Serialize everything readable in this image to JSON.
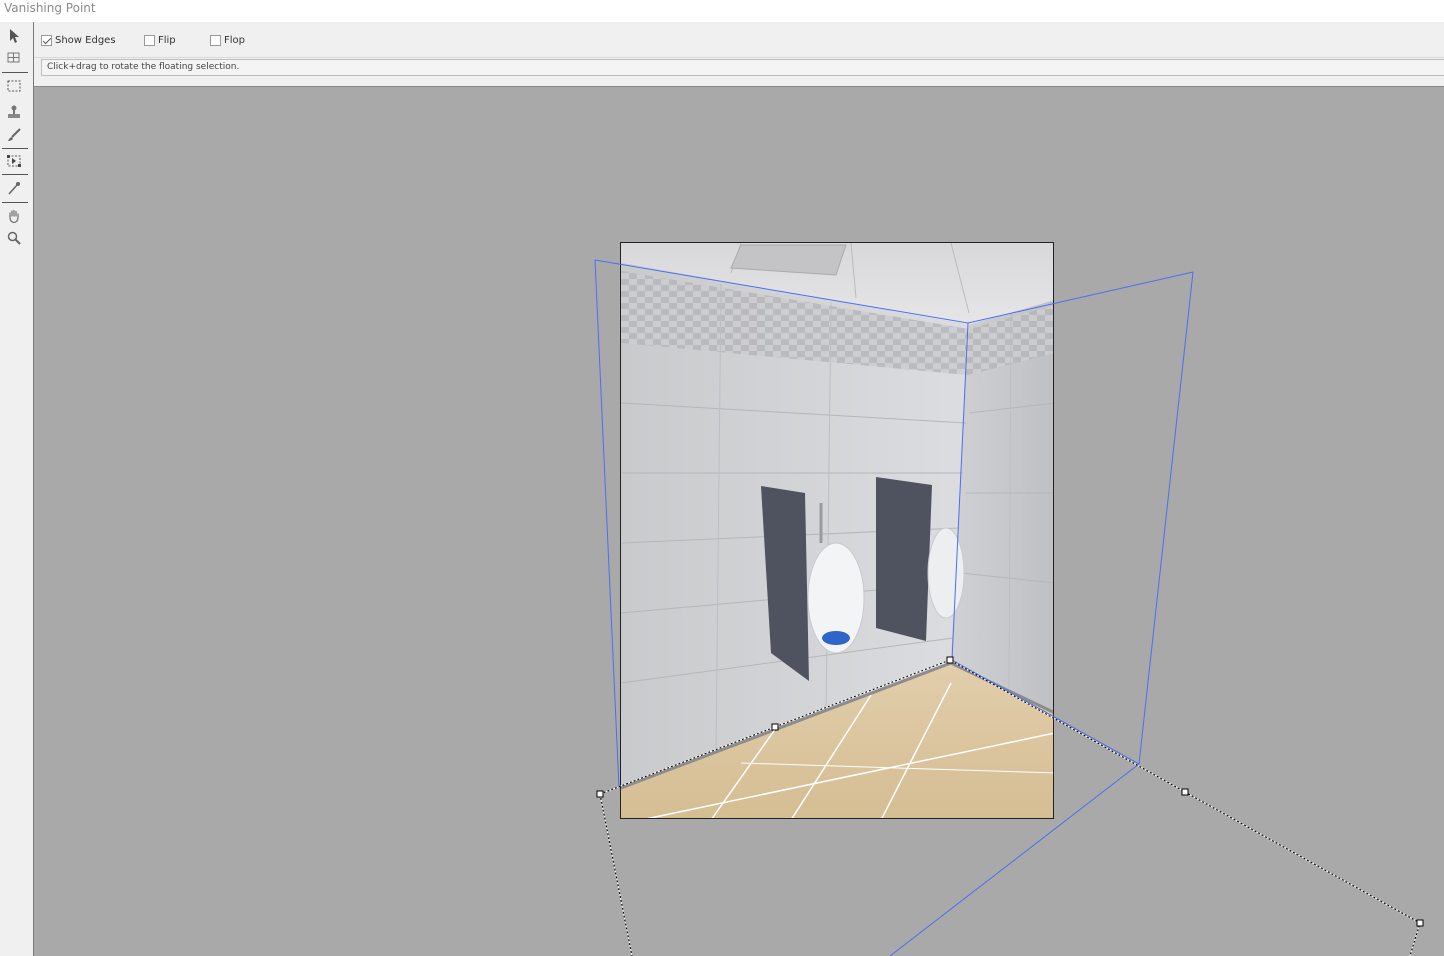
{
  "window": {
    "title": "Vanishing Point"
  },
  "options": {
    "show_edges": {
      "label": "Show Edges",
      "checked": true
    },
    "flip": {
      "label": "Flip",
      "checked": false
    },
    "flop": {
      "label": "Flop",
      "checked": false
    }
  },
  "status": {
    "message": "Click+drag to rotate the floating selection."
  },
  "tools": [
    {
      "name": "edit-plane-tool-icon"
    },
    {
      "name": "create-plane-tool-icon"
    },
    {
      "name": "marquee-tool-icon"
    },
    {
      "name": "stamp-tool-icon"
    },
    {
      "name": "brush-tool-icon"
    },
    {
      "name": "transform-tool-icon"
    },
    {
      "name": "eyedropper-tool-icon"
    },
    {
      "name": "hand-tool-icon"
    },
    {
      "name": "zoom-tool-icon"
    }
  ],
  "colors": {
    "plane_grid": "#4a6ff0",
    "canvas": "#a9a9a9",
    "panel": "#f0f0f0"
  }
}
